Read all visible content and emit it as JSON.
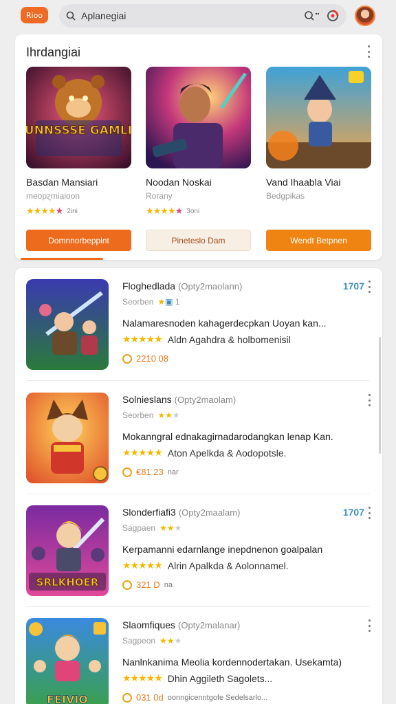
{
  "topbar": {
    "brand_label": "Rioo",
    "search_query": "Aplanegiai"
  },
  "featured": {
    "title": "Ihrdangiai",
    "items": [
      {
        "name": "Basdan Mansiari",
        "sub": "meopɀmiaioon",
        "count": "2ini",
        "button": "Domnnorbeppint",
        "art_text": "GUNNSSSE GAMLIN"
      },
      {
        "name": "Noodan Noskai",
        "sub": "Rorany",
        "count": "3oni",
        "button": "Pineteslo Dam",
        "art_text": ""
      },
      {
        "name": "Vand Ihaabla Viai",
        "sub": "Bedgpikas",
        "count": "",
        "button": "Wendt Betpnen",
        "art_text": ""
      }
    ]
  },
  "list": {
    "rows": [
      {
        "title": "Floghedlada",
        "tag": "(Opty2maolann)",
        "score": "1707",
        "sub": "Seorben",
        "desc": "Nalamaresnoden kahagerdecpkan Uoyan kan...",
        "developer": "Aldn Agahdra & holbomenisil",
        "meta": "2210 08",
        "extra": "",
        "art_text": ""
      },
      {
        "title": "Solnieslans",
        "tag": "(Opty2maolam)",
        "score": "",
        "sub": "Seorben",
        "desc": "Mokanngral ednakagirnadarodangkan lenap Kan.",
        "developer": "Aton Apelkda & Aodopotsle.",
        "meta": "€81 23",
        "extra": "nar",
        "art_text": ""
      },
      {
        "title": "Slonderfiafi3",
        "tag": "(Opty2maalam)",
        "score": "1707",
        "sub": "Sagpaen",
        "desc": "Kerpamanni edarnlange inepdnenon goalpalan",
        "developer": "Alrin Apalkda & Aolonnamel.",
        "meta": "321 D",
        "extra": "na",
        "art_text": "SRLKHOER"
      },
      {
        "title": "Slaomfiques",
        "tag": "(Opty2malanar)",
        "score": "",
        "sub": "Sagpeon",
        "desc": "Nanlnkanima Meolia kordennodertakan. Usekamta)",
        "developer": "Dhin Aggileth Sagolets...",
        "meta": "031 0d",
        "extra": "oonngicenntgofe Sedelsarlo...",
        "art_text": "FEIVIO"
      }
    ]
  }
}
